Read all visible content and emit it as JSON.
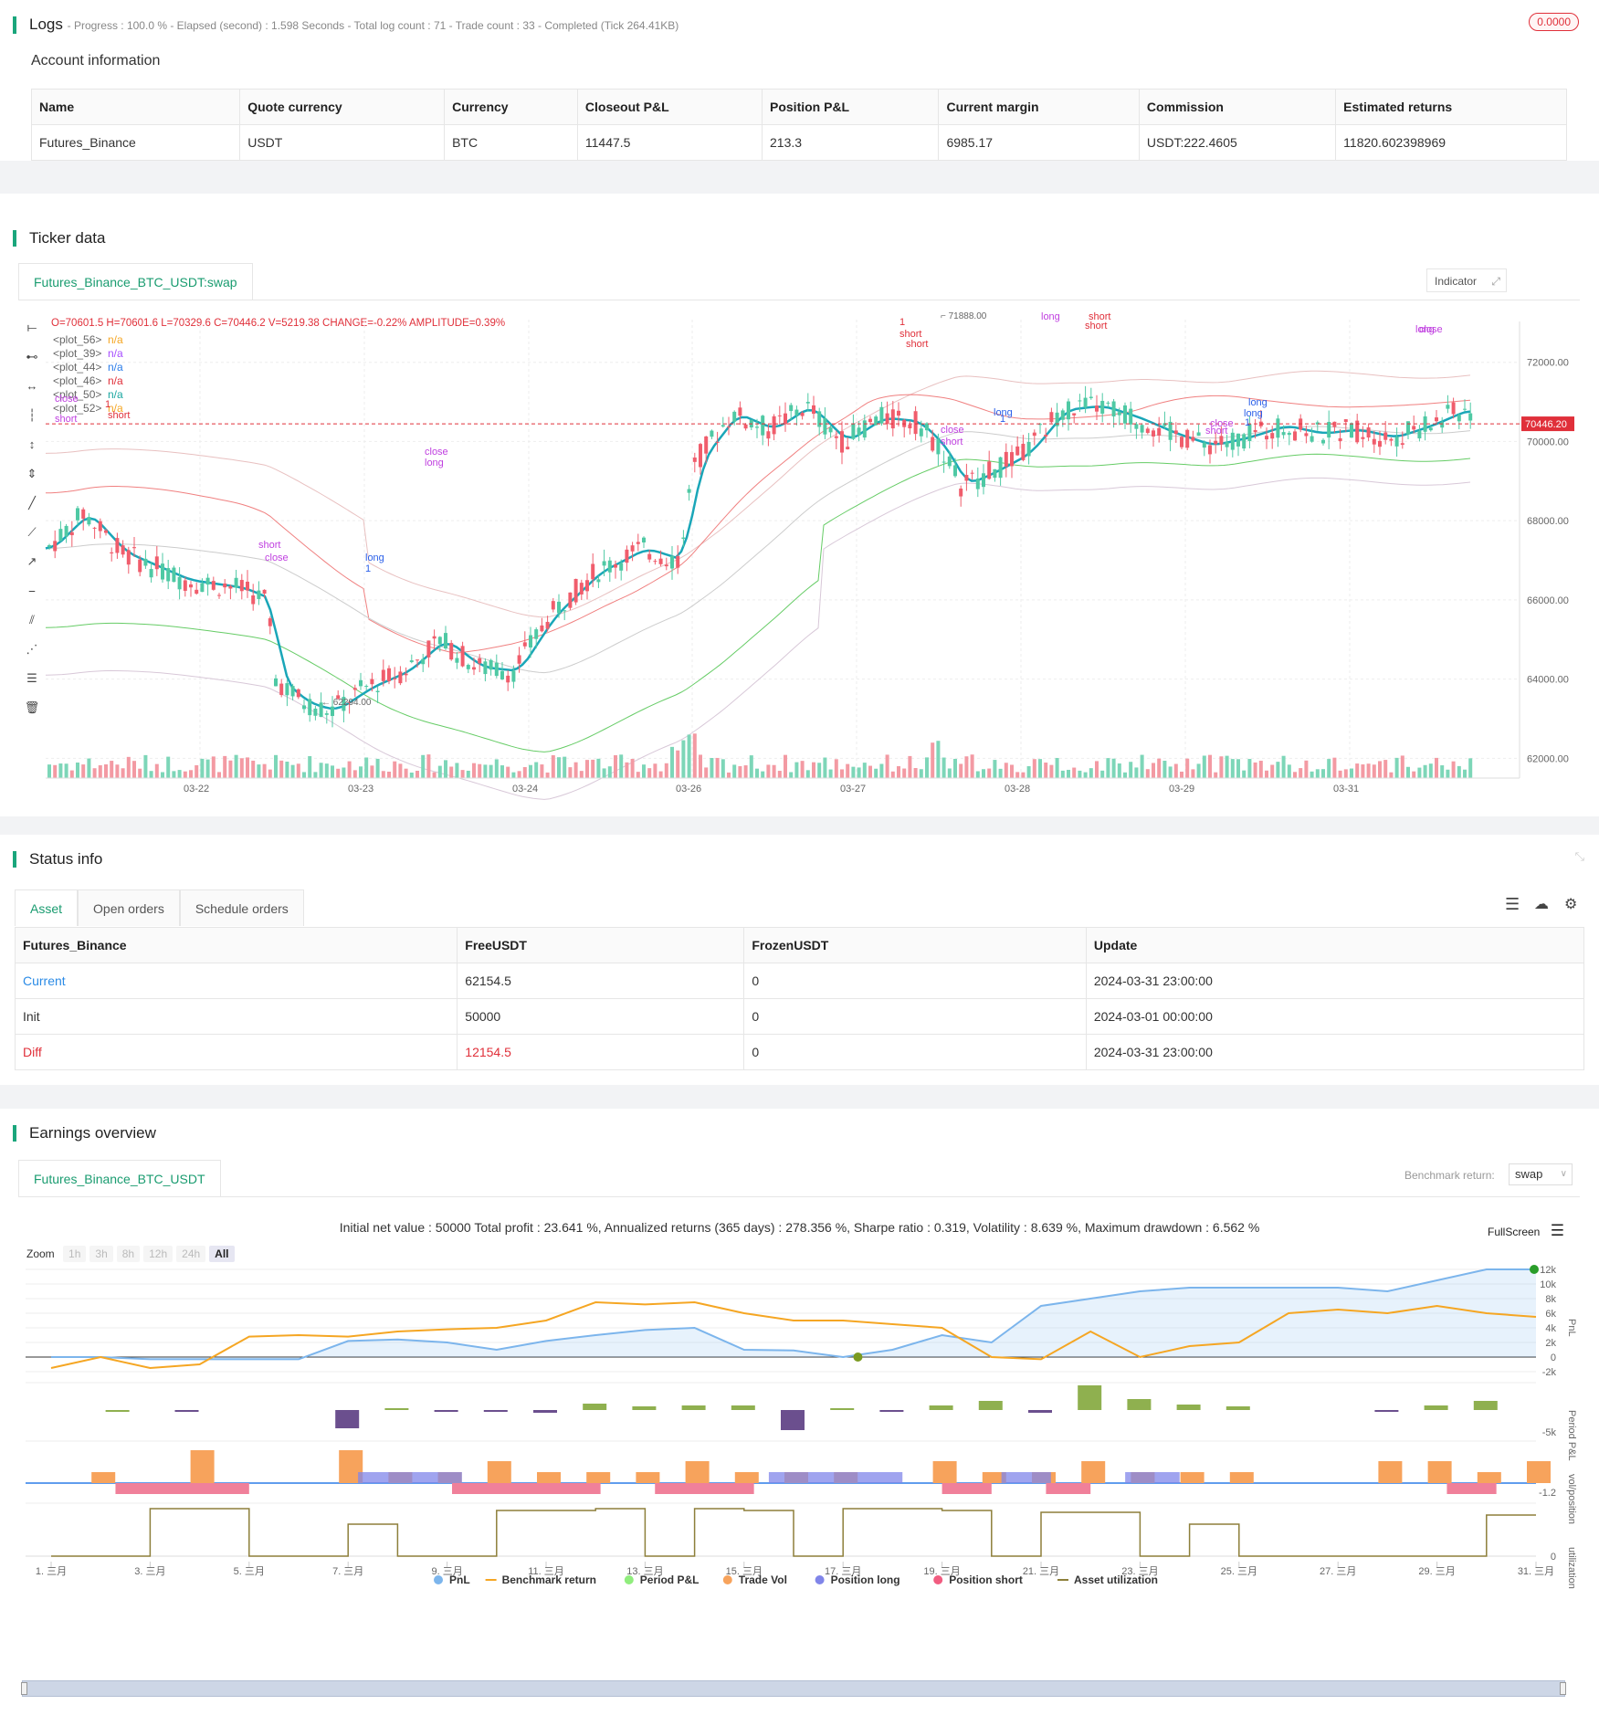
{
  "logs": {
    "title": "Logs",
    "progress_text": "- Progress : 100.0 % - Elapsed (second) : 1.598  Seconds - Total log count : 71 - Trade count : 33 - Completed (Tick 264.41KB)",
    "badge": "0.0000"
  },
  "account": {
    "title": "Account information",
    "headers": [
      "Name",
      "Quote currency",
      "Currency",
      "Closeout P&L",
      "Position P&L",
      "Current margin",
      "Commission",
      "Estimated returns"
    ],
    "row": [
      "Futures_Binance",
      "USDT",
      "BTC",
      "11447.5",
      "213.3",
      "6985.17",
      "USDT:222.4605",
      "11820.602398969"
    ]
  },
  "ticker": {
    "title": "Ticker data",
    "tab": "Futures_Binance_BTC_USDT:swap",
    "ohlc": "O=70601.5 H=70601.6 L=70329.6 C=70446.2 V=5219.38 CHANGE=-0.22% AMPLITUDE=0.39%",
    "indicator_btn": "Indicator",
    "plots": [
      {
        "name": "<plot_56>",
        "value": "n/a",
        "color": "#f5a623"
      },
      {
        "name": "<plot_39>",
        "value": "n/a",
        "color": "#a64dff"
      },
      {
        "name": "<plot_44>",
        "value": "n/a",
        "color": "#2b7de9"
      },
      {
        "name": "<plot_46>",
        "value": "n/a",
        "color": "#e0303a"
      },
      {
        "name": "<plot_50>",
        "value": "n/a",
        "color": "#1aa6a0"
      },
      {
        "name": "<plot_52>",
        "value": "n/a",
        "color": "#f5a623"
      }
    ],
    "price_ticks": [
      "72000.00",
      "70000.00",
      "68000.00",
      "66000.00",
      "64000.00",
      "62000.00"
    ],
    "current_price": "70446.20",
    "date_ticks": [
      "03-22",
      "03-23",
      "03-24",
      "03-26",
      "03-27",
      "03-28",
      "03-29",
      "03-31"
    ],
    "high_label": "71888.00",
    "low_label": "62294.00"
  },
  "status": {
    "title": "Status info",
    "tabs": [
      "Asset",
      "Open orders",
      "Schedule orders"
    ],
    "headers": [
      "Futures_Binance",
      "FreeUSDT",
      "FrozenUSDT",
      "Update"
    ],
    "rows": [
      [
        "Current",
        "62154.5",
        "0",
        "2024-03-31 23:00:00"
      ],
      [
        "Init",
        "50000",
        "0",
        "2024-03-01 00:00:00"
      ],
      [
        "Diff",
        "12154.5",
        "0",
        "2024-03-31 23:00:00"
      ]
    ]
  },
  "earnings": {
    "title": "Earnings overview",
    "tab": "Futures_Binance_BTC_USDT",
    "benchmark_label": "Benchmark return:",
    "benchmark_value": "swap",
    "summary": "Initial net value : 50000 Total profit : 23.641 %, Annualized returns (365 days) : 278.356 %, Sharpe ratio : 0.319, Volatility : 8.639 %, Maximum drawdown : 6.562 %",
    "fullscreen": "FullScreen",
    "zoom_label": "Zoom",
    "zoom_buttons": [
      "1h",
      "3h",
      "8h",
      "12h",
      "24h",
      "All"
    ],
    "pnl_ticks": [
      "12k",
      "10k",
      "8k",
      "6k",
      "4k",
      "2k",
      "0",
      "-2k"
    ],
    "axis_titles": [
      "PnL",
      "Period P&L",
      "vol/position",
      "utilization"
    ],
    "period_tick": "-5k",
    "vol_tick": "-1.2",
    "util_tick": "0",
    "x_ticks": [
      "1. 三月",
      "3. 三月",
      "5. 三月",
      "7. 三月",
      "9. 三月",
      "11. 三月",
      "13. 三月",
      "15. 三月",
      "17. 三月",
      "19. 三月",
      "21. 三月",
      "23. 三月",
      "25. 三月",
      "27. 三月",
      "29. 三月",
      "31. 三月"
    ],
    "legend": [
      {
        "label": "PnL",
        "color": "#7cb5ec"
      },
      {
        "label": "Benchmark return",
        "color": "#f5a623"
      },
      {
        "label": "Period P&L",
        "color": "#90ed7d"
      },
      {
        "label": "Trade Vol",
        "color": "#f7a35c"
      },
      {
        "label": "Position long",
        "color": "#8085e9"
      },
      {
        "label": "Position short",
        "color": "#f15c80"
      },
      {
        "label": "Asset utilization",
        "color": "#8d7f3a"
      }
    ]
  },
  "chart_data": {
    "type": "line",
    "x_days": [
      1,
      2,
      3,
      4,
      5,
      6,
      7,
      8,
      9,
      10,
      11,
      12,
      13,
      14,
      15,
      16,
      17,
      18,
      19,
      20,
      21,
      22,
      23,
      24,
      25,
      26,
      27,
      28,
      29,
      30,
      31
    ],
    "series": [
      {
        "name": "PnL",
        "values": [
          0,
          0,
          -300,
          -300,
          -300,
          -300,
          2200,
          2400,
          2000,
          1000,
          2200,
          3000,
          3700,
          4000,
          1000,
          900,
          0,
          1000,
          3000,
          2000,
          7000,
          8000,
          9000,
          9500,
          9500,
          9500,
          9500,
          9000,
          10500,
          12000,
          12000
        ]
      },
      {
        "name": "Benchmark return",
        "values": [
          -1500,
          0,
          -1500,
          -1000,
          2800,
          3000,
          2800,
          3500,
          3800,
          4000,
          5000,
          7500,
          7200,
          7500,
          6000,
          5000,
          5000,
          4500,
          4000,
          0,
          -300,
          3500,
          0,
          1500,
          2000,
          6000,
          6500,
          6000,
          7000,
          6000,
          5500
        ]
      }
    ],
    "ylim": [
      -2000,
      12000
    ]
  }
}
